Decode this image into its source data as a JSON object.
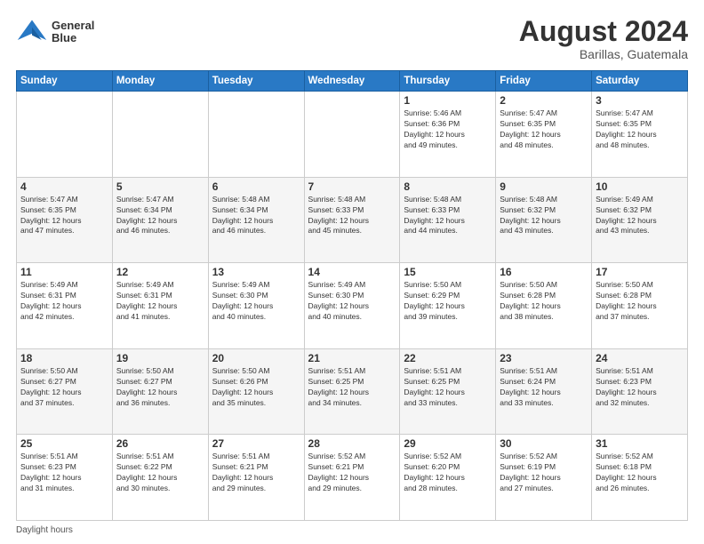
{
  "header": {
    "logo_line1": "General",
    "logo_line2": "Blue",
    "month": "August 2024",
    "location": "Barillas, Guatemala"
  },
  "weekdays": [
    "Sunday",
    "Monday",
    "Tuesday",
    "Wednesday",
    "Thursday",
    "Friday",
    "Saturday"
  ],
  "footer_label": "Daylight hours",
  "weeks": [
    [
      {
        "day": "",
        "info": ""
      },
      {
        "day": "",
        "info": ""
      },
      {
        "day": "",
        "info": ""
      },
      {
        "day": "",
        "info": ""
      },
      {
        "day": "1",
        "info": "Sunrise: 5:46 AM\nSunset: 6:36 PM\nDaylight: 12 hours\nand 49 minutes."
      },
      {
        "day": "2",
        "info": "Sunrise: 5:47 AM\nSunset: 6:35 PM\nDaylight: 12 hours\nand 48 minutes."
      },
      {
        "day": "3",
        "info": "Sunrise: 5:47 AM\nSunset: 6:35 PM\nDaylight: 12 hours\nand 48 minutes."
      }
    ],
    [
      {
        "day": "4",
        "info": "Sunrise: 5:47 AM\nSunset: 6:35 PM\nDaylight: 12 hours\nand 47 minutes."
      },
      {
        "day": "5",
        "info": "Sunrise: 5:47 AM\nSunset: 6:34 PM\nDaylight: 12 hours\nand 46 minutes."
      },
      {
        "day": "6",
        "info": "Sunrise: 5:48 AM\nSunset: 6:34 PM\nDaylight: 12 hours\nand 46 minutes."
      },
      {
        "day": "7",
        "info": "Sunrise: 5:48 AM\nSunset: 6:33 PM\nDaylight: 12 hours\nand 45 minutes."
      },
      {
        "day": "8",
        "info": "Sunrise: 5:48 AM\nSunset: 6:33 PM\nDaylight: 12 hours\nand 44 minutes."
      },
      {
        "day": "9",
        "info": "Sunrise: 5:48 AM\nSunset: 6:32 PM\nDaylight: 12 hours\nand 43 minutes."
      },
      {
        "day": "10",
        "info": "Sunrise: 5:49 AM\nSunset: 6:32 PM\nDaylight: 12 hours\nand 43 minutes."
      }
    ],
    [
      {
        "day": "11",
        "info": "Sunrise: 5:49 AM\nSunset: 6:31 PM\nDaylight: 12 hours\nand 42 minutes."
      },
      {
        "day": "12",
        "info": "Sunrise: 5:49 AM\nSunset: 6:31 PM\nDaylight: 12 hours\nand 41 minutes."
      },
      {
        "day": "13",
        "info": "Sunrise: 5:49 AM\nSunset: 6:30 PM\nDaylight: 12 hours\nand 40 minutes."
      },
      {
        "day": "14",
        "info": "Sunrise: 5:49 AM\nSunset: 6:30 PM\nDaylight: 12 hours\nand 40 minutes."
      },
      {
        "day": "15",
        "info": "Sunrise: 5:50 AM\nSunset: 6:29 PM\nDaylight: 12 hours\nand 39 minutes."
      },
      {
        "day": "16",
        "info": "Sunrise: 5:50 AM\nSunset: 6:28 PM\nDaylight: 12 hours\nand 38 minutes."
      },
      {
        "day": "17",
        "info": "Sunrise: 5:50 AM\nSunset: 6:28 PM\nDaylight: 12 hours\nand 37 minutes."
      }
    ],
    [
      {
        "day": "18",
        "info": "Sunrise: 5:50 AM\nSunset: 6:27 PM\nDaylight: 12 hours\nand 37 minutes."
      },
      {
        "day": "19",
        "info": "Sunrise: 5:50 AM\nSunset: 6:27 PM\nDaylight: 12 hours\nand 36 minutes."
      },
      {
        "day": "20",
        "info": "Sunrise: 5:50 AM\nSunset: 6:26 PM\nDaylight: 12 hours\nand 35 minutes."
      },
      {
        "day": "21",
        "info": "Sunrise: 5:51 AM\nSunset: 6:25 PM\nDaylight: 12 hours\nand 34 minutes."
      },
      {
        "day": "22",
        "info": "Sunrise: 5:51 AM\nSunset: 6:25 PM\nDaylight: 12 hours\nand 33 minutes."
      },
      {
        "day": "23",
        "info": "Sunrise: 5:51 AM\nSunset: 6:24 PM\nDaylight: 12 hours\nand 33 minutes."
      },
      {
        "day": "24",
        "info": "Sunrise: 5:51 AM\nSunset: 6:23 PM\nDaylight: 12 hours\nand 32 minutes."
      }
    ],
    [
      {
        "day": "25",
        "info": "Sunrise: 5:51 AM\nSunset: 6:23 PM\nDaylight: 12 hours\nand 31 minutes."
      },
      {
        "day": "26",
        "info": "Sunrise: 5:51 AM\nSunset: 6:22 PM\nDaylight: 12 hours\nand 30 minutes."
      },
      {
        "day": "27",
        "info": "Sunrise: 5:51 AM\nSunset: 6:21 PM\nDaylight: 12 hours\nand 29 minutes."
      },
      {
        "day": "28",
        "info": "Sunrise: 5:52 AM\nSunset: 6:21 PM\nDaylight: 12 hours\nand 29 minutes."
      },
      {
        "day": "29",
        "info": "Sunrise: 5:52 AM\nSunset: 6:20 PM\nDaylight: 12 hours\nand 28 minutes."
      },
      {
        "day": "30",
        "info": "Sunrise: 5:52 AM\nSunset: 6:19 PM\nDaylight: 12 hours\nand 27 minutes."
      },
      {
        "day": "31",
        "info": "Sunrise: 5:52 AM\nSunset: 6:18 PM\nDaylight: 12 hours\nand 26 minutes."
      }
    ]
  ]
}
